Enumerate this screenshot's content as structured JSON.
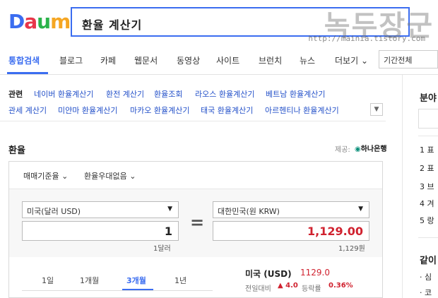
{
  "header": {
    "logo": [
      "D",
      "a",
      "u",
      "m"
    ],
    "search_query": "환율 계산기",
    "watermark": "녹두장군",
    "watermark_url": "http://mainia.tistory.com"
  },
  "tabs": {
    "items": [
      "통합검색",
      "블로그",
      "카페",
      "웹문서",
      "동영상",
      "사이트",
      "브런치",
      "뉴스"
    ],
    "more": "더보기",
    "period": "기간전체"
  },
  "related": {
    "title": "관련",
    "row1": [
      "네이버 환율계산기",
      "환전 계산기",
      "환율조회",
      "라오스 환율계산기",
      "베트남 환율계산기"
    ],
    "row2": [
      "관세 계산기",
      "미얀마 환율계산기",
      "마카오 환율계산기",
      "태국 환율계산기",
      "아르헨티나 환율계산기"
    ]
  },
  "sidebar": {
    "title1": "분야",
    "ranks": [
      "1 표",
      "2 표",
      "3 브",
      "4 겨",
      "5 랑"
    ],
    "title2": "같이",
    "items": [
      "· 심",
      "· 코"
    ]
  },
  "exchange": {
    "title": "환율",
    "provider_label": "제공:",
    "provider_name": "하나은행",
    "options": [
      "매매기준율",
      "환율우대없음"
    ],
    "from_currency": "미국(달러 USD)",
    "to_currency": "대한민국(원 KRW)",
    "from_amount": "1",
    "to_amount": "1,129.00",
    "from_unit": "1달러",
    "to_unit": "1,129원",
    "periods": [
      "1일",
      "1개월",
      "3개월",
      "1년"
    ],
    "active_period": 2,
    "rate_name": "미국 (USD)",
    "rate_value": "1129.0",
    "change_label": "전일대비",
    "change_value": "▲ 4.0",
    "pct_label": "등락률",
    "pct_value": "0.36%",
    "colors": {
      "accent": "#3b6df0",
      "up": "#d0222f"
    }
  }
}
